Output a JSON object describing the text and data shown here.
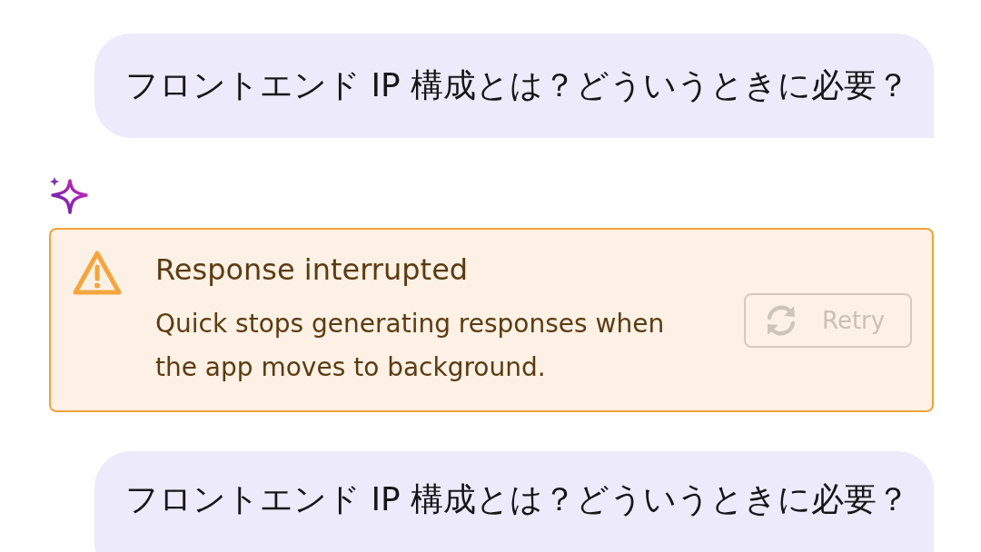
{
  "messages": [
    {
      "kind": "user",
      "text": "フロントエンド IP 構成とは？どういうときに必要？"
    },
    {
      "kind": "assistant",
      "error": {
        "title": "Response interrupted",
        "body": "Quick stops generating responses when the app moves to background.",
        "retry": {
          "label": "Retry",
          "disabled": true
        }
      }
    },
    {
      "kind": "user",
      "text": "フロントエンド IP 構成とは？どういうときに必要？"
    }
  ]
}
